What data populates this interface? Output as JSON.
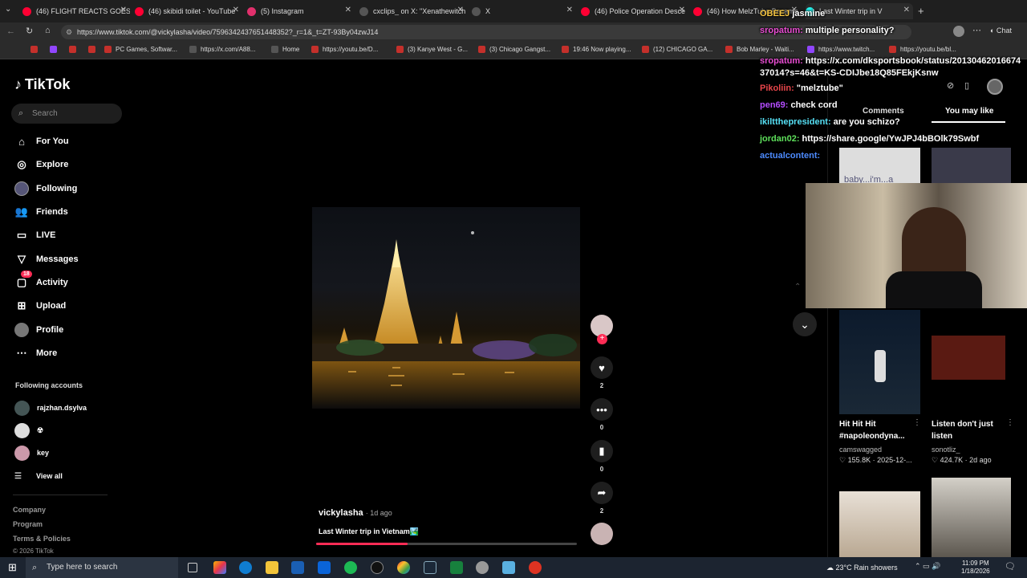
{
  "browser": {
    "tabs": [
      {
        "title": "(46) FLIGHT REACTS GOES O",
        "color": "#ff0033"
      },
      {
        "title": "(46) skibidi toilet - YouTube",
        "color": "#ff0033"
      },
      {
        "title": "(5) Instagram",
        "color": "#e1306c"
      },
      {
        "title": "cxclips_ on X: \"Xenathewitch",
        "color": "#111111"
      },
      {
        "title": "X",
        "color": "#111111"
      },
      {
        "title": "(46) Police Operation Desce",
        "color": "#ff0033"
      },
      {
        "title": "(46) How MelzTube Became",
        "color": "#ff0033"
      },
      {
        "title": "Last Winter trip in V",
        "color": "#25f4ee"
      }
    ],
    "url": "https://www.tiktok.com/@vickylasha/video/7596342437651448352?_r=1&_t=ZT-93By04zwJ14",
    "bookmarks": [
      "PC Games, Softwar...",
      "https://x.com/A88...",
      "Home",
      "https://youtu.be/D...",
      "(3) Kanye West - G...",
      "(3) Chicago Gangst...",
      "19:46 Now playing...",
      "(12) CHICAGO GA...",
      "Bob Marley - Waiti...",
      "https://www.twitch...",
      "https://youtu.be/bl..."
    ]
  },
  "sidebar": {
    "logo": "TikTok",
    "search_placeholder": "Search",
    "nav": [
      {
        "label": "For You",
        "icon": "home-icon"
      },
      {
        "label": "Explore",
        "icon": "compass-icon"
      },
      {
        "label": "Following",
        "icon": "following-avatar-icon"
      },
      {
        "label": "Friends",
        "icon": "friends-icon"
      },
      {
        "label": "LIVE",
        "icon": "live-icon"
      },
      {
        "label": "Messages",
        "icon": "messages-icon"
      },
      {
        "label": "Activity",
        "icon": "activity-icon",
        "badge": "18"
      },
      {
        "label": "Upload",
        "icon": "upload-icon"
      },
      {
        "label": "Profile",
        "icon": "profile-avatar-icon"
      },
      {
        "label": "More",
        "icon": "more-icon"
      }
    ],
    "following_title": "Following accounts",
    "accounts": [
      "rajzhan.dsylva",
      "☢",
      "key"
    ],
    "view_all": "View all",
    "footer": [
      "Company",
      "Program",
      "Terms & Policies",
      "© 2026 TikTok"
    ]
  },
  "video": {
    "author": "vickylasha",
    "age": "· 1d ago",
    "caption": "Last Winter trip in Vietnam🏞️",
    "progress": 0.35,
    "actions": [
      {
        "name": "like",
        "icon": "heart-icon",
        "count": "2"
      },
      {
        "name": "comment",
        "icon": "comment-icon",
        "count": "0"
      },
      {
        "name": "save",
        "icon": "bookmark-icon",
        "count": "0"
      },
      {
        "name": "share",
        "icon": "share-icon",
        "count": "2"
      }
    ]
  },
  "right_rail": {
    "tabs": [
      "Comments",
      "You may like"
    ],
    "cards": [
      {
        "title": "Hit Hit Hit #napoleondyna...",
        "author": "camswagged",
        "stats": "♡ 155.8K · 2025-12-..."
      },
      {
        "title": "Listen don't just listen",
        "author": "sonotliz_",
        "stats": "♡ 424.7K · 2d ago"
      }
    ],
    "thumb_text": "baby...i'm...a"
  },
  "chat": [
    {
      "user": "OBEEJ",
      "msg": "jasmine",
      "color": "#f5c542"
    },
    {
      "user": "sropatum:",
      "msg": "multiple personality?",
      "color": "#e84dd2"
    },
    {
      "user": "sropatum:",
      "msg": "https://x.com/dksportsbook/status/2013046201667437014?s=46&t=KS-CDIJbe18Q85FEkjKsnw",
      "color": "#e84dd2"
    },
    {
      "user": "Pikoliin:",
      "msg": "\"melztube\"",
      "color": "#e8454a"
    },
    {
      "user": "pen69:",
      "msg": "check cord",
      "color": "#b44dff"
    },
    {
      "user": "ikiltthepresident:",
      "msg": "are you schizo?",
      "color": "#56e0f5"
    },
    {
      "user": "jordan02:",
      "msg": "https://share.google/YwJPJ4bBOlk79Swbf",
      "color": "#5ee05b"
    },
    {
      "user": "actualcontent:",
      "msg": "",
      "color": "#4d8bff"
    }
  ],
  "taskbar": {
    "search_placeholder": "Type here to search",
    "weather": "23°C  Rain showers",
    "time": "11:09 PM",
    "date": "1/18/2026"
  }
}
